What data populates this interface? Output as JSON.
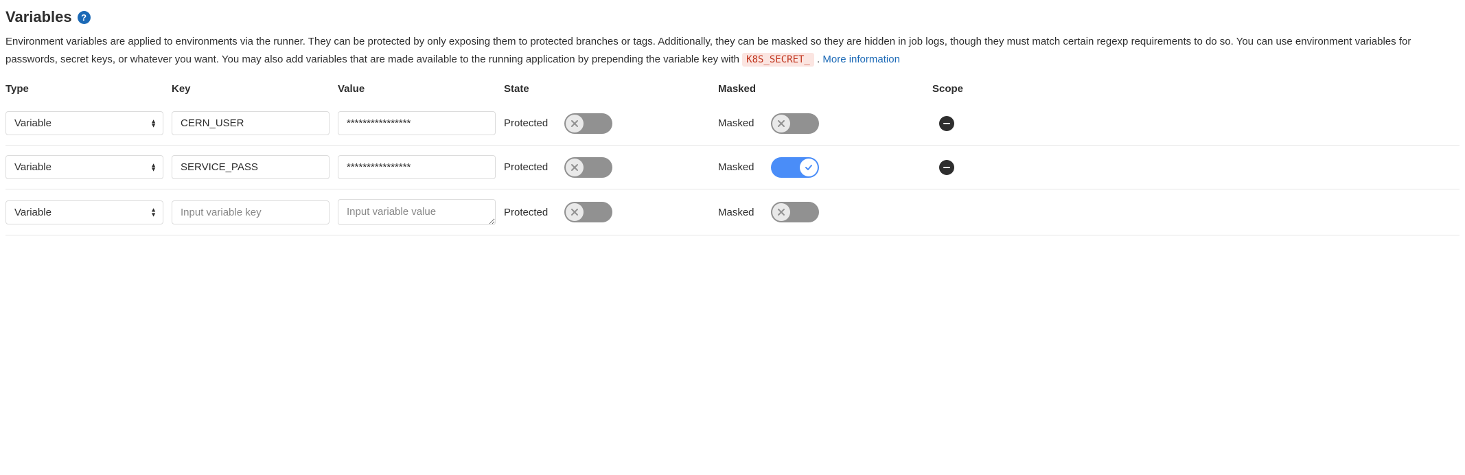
{
  "section": {
    "title": "Variables",
    "help_tooltip": "?"
  },
  "description": {
    "text": "Environment variables are applied to environments via the runner. They can be protected by only exposing them to protected branches or tags. Additionally, they can be masked so they are hidden in job logs, though they must match certain regexp requirements to do so. You can use environment variables for passwords, secret keys, or whatever you want. You may also add variables that are made available to the running application by prepending the variable key with",
    "code": "K8S_SECRET_",
    "period": ".",
    "more_link": "More information"
  },
  "columns": {
    "type": "Type",
    "key": "Key",
    "value": "Value",
    "state": "State",
    "masked": "Masked",
    "scope": "Scope"
  },
  "labels": {
    "state_protected": "Protected",
    "masked": "Masked",
    "type_option_variable": "Variable",
    "key_placeholder": "Input variable key",
    "value_placeholder": "Input variable value"
  },
  "rows": [
    {
      "type": "Variable",
      "key": "CERN_USER",
      "value": "****************",
      "protected": false,
      "masked": false,
      "removable": true
    },
    {
      "type": "Variable",
      "key": "SERVICE_PASS",
      "value": "****************",
      "protected": false,
      "masked": true,
      "removable": true
    },
    {
      "type": "Variable",
      "key": "",
      "value": "",
      "protected": false,
      "masked": false,
      "removable": false
    }
  ]
}
